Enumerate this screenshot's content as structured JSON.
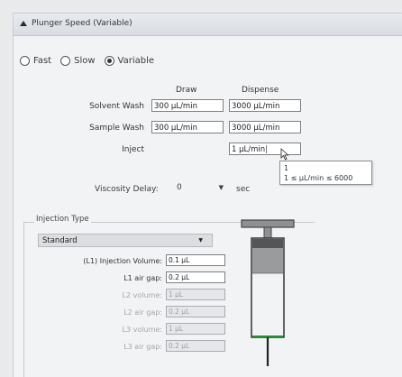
{
  "header": {
    "title": "Plunger Speed (Variable)"
  },
  "speed_mode": {
    "options": [
      {
        "label": "Fast",
        "selected": false
      },
      {
        "label": "Slow",
        "selected": false
      },
      {
        "label": "Variable",
        "selected": true
      }
    ]
  },
  "columns": {
    "draw": "Draw",
    "dispense": "Dispense"
  },
  "rows": {
    "solvent_wash": {
      "label": "Solvent Wash",
      "draw": "300 µL/min",
      "dispense": "3000 µL/min"
    },
    "sample_wash": {
      "label": "Sample Wash",
      "draw": "300 µL/min",
      "dispense": "3000 µL/min"
    },
    "inject": {
      "label": "Inject",
      "dispense": "1 µL/min"
    }
  },
  "tooltip": {
    "line1": "1",
    "line2": "1 ≤ µL/min ≤ 6000"
  },
  "viscosity": {
    "label": "Viscosity Delay:",
    "value": "0",
    "unit": "sec"
  },
  "injection_type": {
    "title": "Injection Type",
    "selected": "Standard",
    "fields": [
      {
        "label": "(L1) Injection Volume:",
        "value": "0.1 µL",
        "enabled": true
      },
      {
        "label": "L1 air gap:",
        "value": "0.2 µL",
        "enabled": true
      },
      {
        "label": "L2 volume:",
        "value": "1 µL",
        "enabled": false
      },
      {
        "label": "L2 air gap:",
        "value": "0.2 µL",
        "enabled": false
      },
      {
        "label": "L3 volume:",
        "value": "1 µL",
        "enabled": false
      },
      {
        "label": "L3 air gap:",
        "value": "0.2 µL",
        "enabled": false
      }
    ]
  },
  "colors": {
    "plunger_accent": "#2a8a3a",
    "syringe_fill": "#9a9b9d"
  }
}
